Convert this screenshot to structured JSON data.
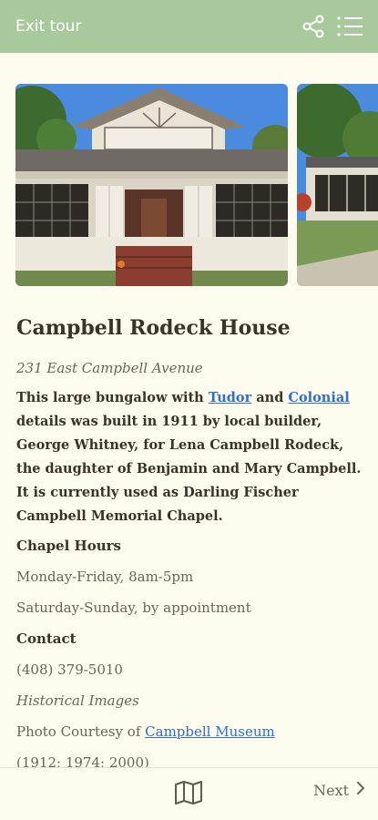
{
  "topbar": {
    "exit_label": "Exit tour",
    "icons": [
      "share-icon",
      "list-icon"
    ],
    "background": "#a7c99b"
  },
  "gallery": {
    "photos": [
      "house-photo-front",
      "house-photo-side"
    ]
  },
  "place": {
    "title": "Campbell Rodeck House",
    "address": "231 East Campbell Avenue",
    "desc_part1": "This large bungalow with ",
    "link_tudor": "Tudor",
    "desc_part2": " and ",
    "link_colonial": "Colonial",
    "desc_part3": " details was built in 1911 by local builder, George Whitney, for Lena Campbell Rodeck, the daughter of Benjamin and Mary Campbell. It is currently used as Darling Fischer Campbell Memorial Chapel."
  },
  "hours": {
    "heading": "Chapel Hours",
    "weekday": "Monday-Friday, 8am-5pm",
    "weekend": "Saturday-Sunday, by appointment"
  },
  "contact": {
    "heading": "Contact",
    "phone": "(408) 379-5010"
  },
  "images": {
    "heading": "Historical Images",
    "credit_prefix": "Photo Courtesy of ",
    "credit_link": "Campbell Museum",
    "years": "(1912; 1974; 2000)"
  },
  "bottombar": {
    "map_icon": "map-icon",
    "next_label": "Next",
    "next_icon": "chevron-right-icon"
  },
  "colors": {
    "accent": "#a7c99b",
    "link": "#2f6fd0",
    "background": "#fdfaee"
  }
}
